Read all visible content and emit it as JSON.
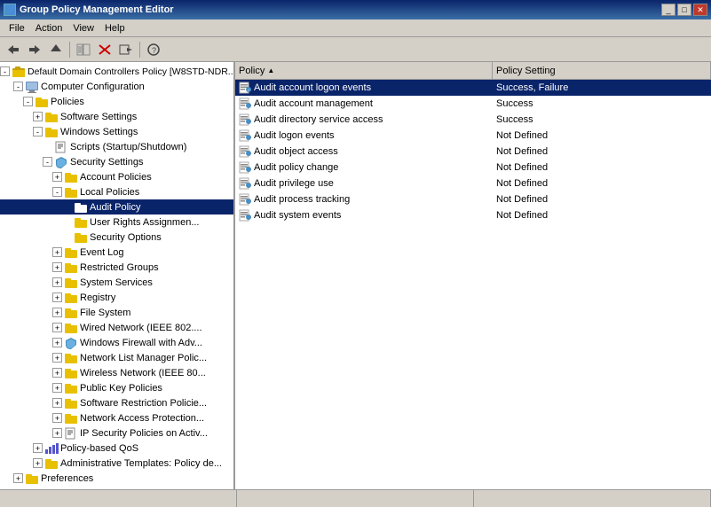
{
  "titleBar": {
    "title": "Group Policy Management Editor",
    "controls": [
      "_",
      "□",
      "X"
    ]
  },
  "menuBar": {
    "items": [
      "File",
      "Action",
      "View",
      "Help"
    ]
  },
  "toolbar": {
    "buttons": [
      "◀",
      "▶",
      "⬆",
      "📋",
      "✖",
      "➡",
      "?",
      "🔍"
    ]
  },
  "treePane": {
    "rootLabel": "Default Domain Controllers Policy [W8STD-NDR...",
    "nodes": [
      {
        "id": "computer-config",
        "label": "Computer Configuration",
        "indent": 1,
        "toggle": "-",
        "icon": "computer",
        "expanded": true
      },
      {
        "id": "policies",
        "label": "Policies",
        "indent": 2,
        "toggle": "+",
        "icon": "folder",
        "expanded": true
      },
      {
        "id": "software-settings",
        "label": "Software Settings",
        "indent": 3,
        "toggle": "+",
        "icon": "folder"
      },
      {
        "id": "windows-settings",
        "label": "Windows Settings",
        "indent": 3,
        "toggle": "-",
        "icon": "folder",
        "expanded": true
      },
      {
        "id": "scripts",
        "label": "Scripts (Startup/Shutdown)",
        "indent": 4,
        "toggle": null,
        "icon": "doc"
      },
      {
        "id": "security-settings",
        "label": "Security Settings",
        "indent": 4,
        "toggle": "-",
        "icon": "shield",
        "expanded": true
      },
      {
        "id": "account-policies",
        "label": "Account Policies",
        "indent": 5,
        "toggle": "+",
        "icon": "folder"
      },
      {
        "id": "local-policies",
        "label": "Local Policies",
        "indent": 5,
        "toggle": "-",
        "icon": "folder",
        "expanded": true
      },
      {
        "id": "audit-policy",
        "label": "Audit Policy",
        "indent": 6,
        "toggle": null,
        "icon": "folder",
        "selected": true
      },
      {
        "id": "user-rights",
        "label": "User Rights Assignmen...",
        "indent": 6,
        "toggle": null,
        "icon": "folder"
      },
      {
        "id": "security-options",
        "label": "Security Options",
        "indent": 6,
        "toggle": null,
        "icon": "folder"
      },
      {
        "id": "event-log",
        "label": "Event Log",
        "indent": 5,
        "toggle": "+",
        "icon": "folder"
      },
      {
        "id": "restricted-groups",
        "label": "Restricted Groups",
        "indent": 5,
        "toggle": "+",
        "icon": "folder"
      },
      {
        "id": "system-services",
        "label": "System Services",
        "indent": 5,
        "toggle": "+",
        "icon": "folder"
      },
      {
        "id": "registry",
        "label": "Registry",
        "indent": 5,
        "toggle": "+",
        "icon": "folder"
      },
      {
        "id": "file-system",
        "label": "File System",
        "indent": 5,
        "toggle": "+",
        "icon": "folder"
      },
      {
        "id": "wired-network",
        "label": "Wired Network (IEEE 802....",
        "indent": 5,
        "toggle": "+",
        "icon": "folder"
      },
      {
        "id": "windows-firewall",
        "label": "Windows Firewall with Adv...",
        "indent": 5,
        "toggle": "+",
        "icon": "shield2"
      },
      {
        "id": "network-list",
        "label": "Network List Manager Polic...",
        "indent": 5,
        "toggle": "+",
        "icon": "folder"
      },
      {
        "id": "wireless-network",
        "label": "Wireless Network (IEEE 80...",
        "indent": 5,
        "toggle": "+",
        "icon": "folder"
      },
      {
        "id": "public-key",
        "label": "Public Key Policies",
        "indent": 5,
        "toggle": "+",
        "icon": "folder"
      },
      {
        "id": "software-restriction",
        "label": "Software Restriction Policie...",
        "indent": 5,
        "toggle": "+",
        "icon": "folder"
      },
      {
        "id": "nap",
        "label": "Network Access Protection...",
        "indent": 5,
        "toggle": "+",
        "icon": "folder"
      },
      {
        "id": "ip-security",
        "label": "IP Security Policies on Activ...",
        "indent": 5,
        "toggle": "+",
        "icon": "doc"
      },
      {
        "id": "policy-qos",
        "label": "Policy-based QoS",
        "indent": 3,
        "toggle": "+",
        "icon": "chart"
      },
      {
        "id": "admin-templates",
        "label": "Administrative Templates: Policy de...",
        "indent": 3,
        "toggle": "+",
        "icon": "folder"
      },
      {
        "id": "preferences",
        "label": "Preferences",
        "indent": 2,
        "toggle": "+",
        "icon": "folder"
      }
    ]
  },
  "listPane": {
    "columns": [
      {
        "id": "policy",
        "label": "Policy",
        "sortAsc": true
      },
      {
        "id": "setting",
        "label": "Policy Setting"
      }
    ],
    "rows": [
      {
        "id": 1,
        "policy": "Audit account logon events",
        "setting": "Success, Failure",
        "selected": true
      },
      {
        "id": 2,
        "policy": "Audit account management",
        "setting": "Success"
      },
      {
        "id": 3,
        "policy": "Audit directory service access",
        "setting": "Success"
      },
      {
        "id": 4,
        "policy": "Audit logon events",
        "setting": "Not Defined"
      },
      {
        "id": 5,
        "policy": "Audit object access",
        "setting": "Not Defined"
      },
      {
        "id": 6,
        "policy": "Audit policy change",
        "setting": "Not Defined"
      },
      {
        "id": 7,
        "policy": "Audit privilege use",
        "setting": "Not Defined"
      },
      {
        "id": 8,
        "policy": "Audit process tracking",
        "setting": "Not Defined"
      },
      {
        "id": 9,
        "policy": "Audit system events",
        "setting": "Not Defined"
      }
    ]
  },
  "statusBar": {
    "panels": [
      "",
      "",
      ""
    ]
  }
}
